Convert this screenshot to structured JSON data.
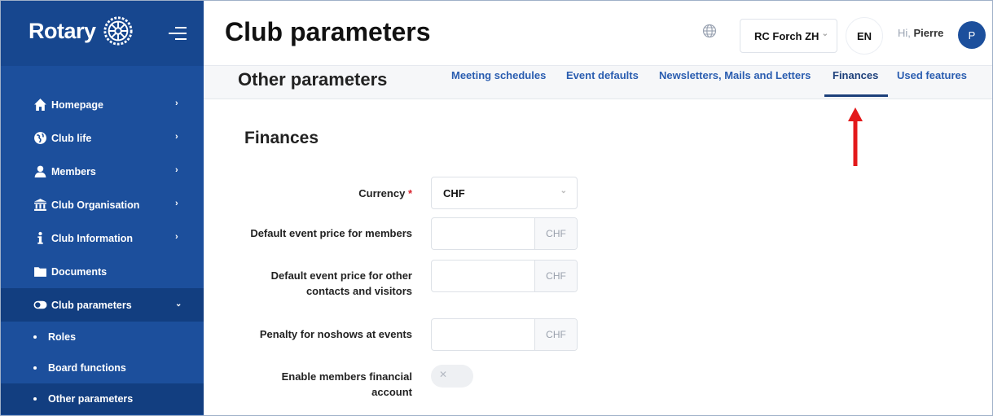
{
  "sidebar": {
    "brand": "Rotary",
    "items": [
      {
        "label": "Homepage",
        "icon": "home-icon"
      },
      {
        "label": "Club life",
        "icon": "globe-icon"
      },
      {
        "label": "Members",
        "icon": "user-icon"
      },
      {
        "label": "Club Organisation",
        "icon": "bank-icon"
      },
      {
        "label": "Club Information",
        "icon": "info-icon"
      },
      {
        "label": "Documents",
        "icon": "folder-icon"
      },
      {
        "label": "Club parameters",
        "icon": "toggle-icon"
      }
    ],
    "subitems": [
      {
        "label": "Roles"
      },
      {
        "label": "Board functions"
      },
      {
        "label": "Other parameters"
      }
    ]
  },
  "header": {
    "title": "Club parameters",
    "club": "RC Forch ZH",
    "lang": "EN",
    "greeting_prefix": "Hi,",
    "user_name": "Pierre",
    "avatar_initial": "P"
  },
  "subheader": {
    "title": "Other parameters",
    "tabs": [
      {
        "label": "Meeting schedules"
      },
      {
        "label": "Event defaults"
      },
      {
        "label": "Newsletters, Mails and Letters"
      },
      {
        "label": "Finances"
      },
      {
        "label": "Used features"
      }
    ]
  },
  "finances": {
    "title": "Finances",
    "currency_label": "Currency",
    "currency_required": "*",
    "currency_value": "CHF",
    "member_price_label": "Default event price for members",
    "other_price_label_1": "Default event price for other",
    "other_price_label_2": "contacts and visitors",
    "penalty_label": "Penalty for noshows at events",
    "financial_account_label_1": "Enable members financial",
    "financial_account_label_2": "account",
    "unit": "CHF",
    "toggle_off_glyph": "✕"
  },
  "colors": {
    "sidebar": "#1c4f9c",
    "sidebar_active": "#123e80",
    "tab_link": "#2a5db0",
    "arrow": "#e3191b",
    "required": "#d9232e"
  }
}
